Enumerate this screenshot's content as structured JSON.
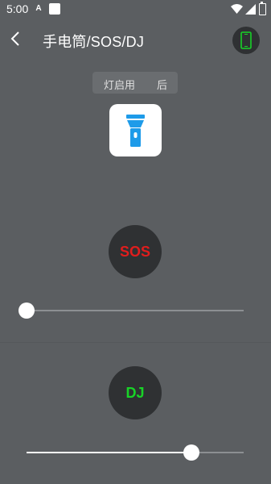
{
  "status_bar": {
    "time": "5:00",
    "notif_icon_a": "A"
  },
  "app_bar": {
    "title": "手电筒/SOS/DJ"
  },
  "flash_tab": {
    "label": "灯启用",
    "label_right": "后"
  },
  "icons": {
    "back": "back-arrow-icon",
    "phone": "phone-icon",
    "flashlight": "flashlight-icon"
  },
  "sos": {
    "label": "SOS",
    "slider_value": 0.0,
    "color": "#e01d1d"
  },
  "dj": {
    "label": "DJ",
    "slider_value": 0.76,
    "color": "#18d327"
  },
  "colors": {
    "background": "#5b5e61",
    "circle": "#2f3133",
    "accent_blue": "#1e9be9",
    "accent_green": "#18d327"
  }
}
